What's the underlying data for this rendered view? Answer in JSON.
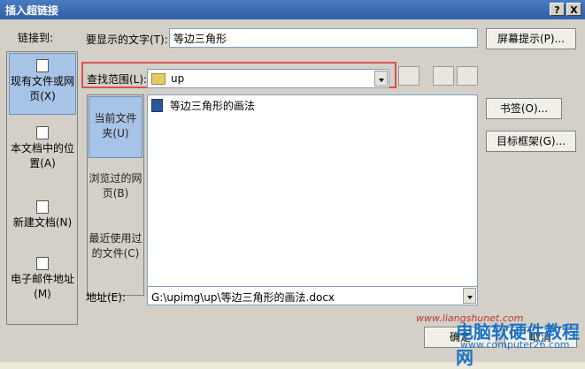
{
  "window": {
    "title": "插入超链接",
    "help_button": "?",
    "close_button": "X"
  },
  "link_to": {
    "label": "链接到:",
    "items": [
      {
        "label": "现有文件或网页(X)",
        "selected": true
      },
      {
        "label": "本文档中的位置(A)",
        "selected": false
      },
      {
        "label": "新建文档(N)",
        "selected": false
      },
      {
        "label": "电子邮件地址(M)",
        "selected": false
      }
    ]
  },
  "display_text": {
    "label": "要显示的文字(T):",
    "value": "等边三角形"
  },
  "screen_tip_button": "屏幕提示(P)...",
  "look_in": {
    "label": "查找范围(L):",
    "value": "up"
  },
  "mid_nav": {
    "items": [
      {
        "label": "当前文件夹(U)",
        "selected": true
      },
      {
        "label": "浏览过的网页(B)",
        "selected": false
      },
      {
        "label": "最近使用过的文件(C)",
        "selected": false
      }
    ]
  },
  "files": [
    {
      "name": "等边三角形的画法"
    }
  ],
  "bookmark_button": "书签(O)...",
  "target_frame_button": "目标框架(G)...",
  "address": {
    "label": "地址(E):",
    "value": "G:\\upimg\\up\\等边三角形的画法.docx"
  },
  "ok_button": "确定",
  "cancel_button": "取消",
  "watermark": {
    "site": "www.liangshunet.com",
    "brand": "电脑软硬件教程网",
    "url": "www.computer26.com"
  },
  "colors": {
    "title_bar": "#2f5fa8",
    "highlight": "#a7c3e6",
    "red_box": "#d9534f"
  }
}
